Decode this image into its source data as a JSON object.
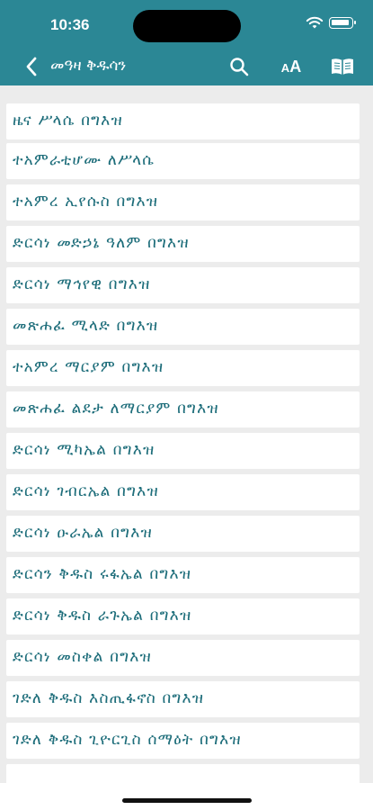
{
  "status_bar": {
    "time": "10:36",
    "icons": [
      "wifi-icon",
      "battery-icon"
    ]
  },
  "nav": {
    "title": "መዓዛ ቅዱሳን",
    "icons": [
      "back-chevron-icon",
      "search-icon",
      "font-size-icon",
      "book-icon"
    ],
    "font_btn_small": "A",
    "font_btn_big": "A"
  },
  "colors": {
    "header": "#2b8795",
    "item_text": "#1d6d7a",
    "list_bg": "#ececec",
    "item_bg": "#ffffff"
  },
  "items": [
    {
      "label": "ዜና ሥላሴ በግእዝ"
    },
    {
      "label": "ተአምራቲሆሙ ለሥላሴ"
    },
    {
      "label": "ተአምረ ኢየሱስ በግእዝ"
    },
    {
      "label": "ድርሳነ መድኃኔ ዓለም በግእዝ"
    },
    {
      "label": "ድርሳነ ማኅየዊ በግእዝ"
    },
    {
      "label": "መጽሐፈ ሚላድ በግእዝ"
    },
    {
      "label": "ተአምረ ማርያም በግእዝ"
    },
    {
      "label": "መጽሐፈ ልደታ ለማርያም በግእዝ"
    },
    {
      "label": "ድርሳነ ሚካኤል በግእዝ"
    },
    {
      "label": "ድርሳነ ገብርኤል በግእዝ"
    },
    {
      "label": "ድርሳነ ዑራኤል በግእዝ"
    },
    {
      "label": "ድርሳን ቅዱስ ሩፋኤል በግእዝ"
    },
    {
      "label": "ድርሳነ ቅዱስ ራጉኤል በግእዝ"
    },
    {
      "label": "ድርሳነ መስቀል በግእዝ"
    },
    {
      "label": "ገድለ ቅዱስ እስጢፋኖስ በግእዝ"
    },
    {
      "label": "ገድለ ቅዱስ ጊዮርጊስ ሰማዕት በግእዝ"
    },
    {
      "label": ""
    }
  ]
}
